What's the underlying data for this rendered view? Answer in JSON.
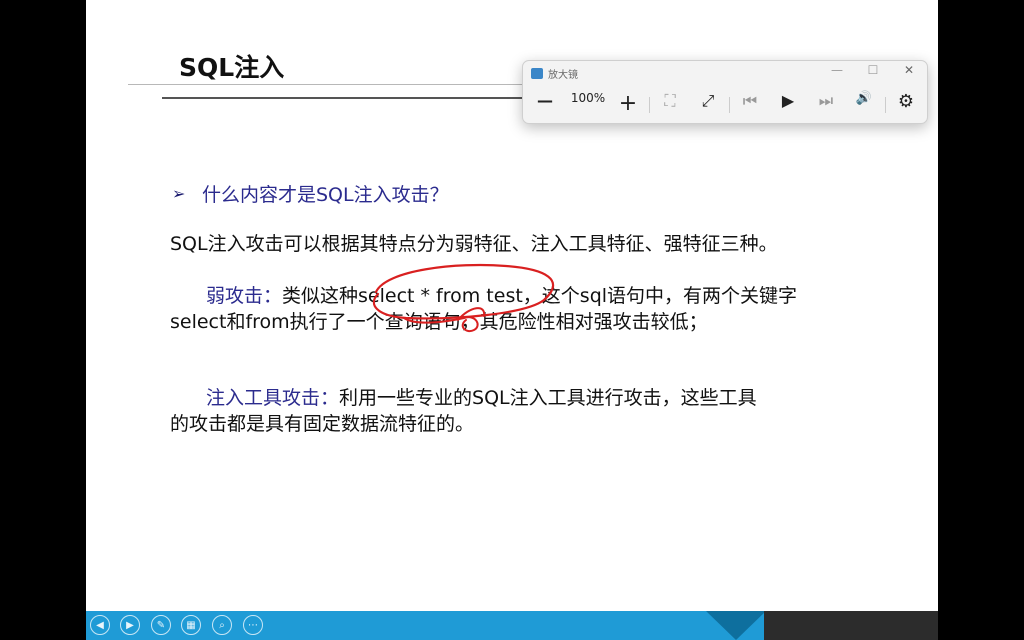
{
  "slide": {
    "title": "SQL注入",
    "bullet_arrow": "➢",
    "bullet_text": "什么内容才是SQL注入攻击？",
    "p1": "SQL注入攻击可以根据其特点分为弱特征、注入工具特征、强特征三种。",
    "p2_label": "弱攻击：",
    "p2_line1": "类似这种select * from test，这个sql语句中，有两个关键字",
    "p2_line2": "select和from执行了一个查询语句，其危险性相对强攻击较低；",
    "p3_label": "注入工具攻击：",
    "p3_line1": "利用一些专业的SQL注入工具进行攻击，这些工具",
    "p3_line2": "的攻击都是具有固定数据流特征的。"
  },
  "magnifier": {
    "title": "放大镜",
    "zoom": "100%",
    "minimize": "—",
    "maximize": "☐",
    "close": "✕",
    "zoom_out": "—",
    "zoom_in": "+",
    "fit": "⛶",
    "expand": "⤢",
    "prev": "⏮",
    "play": "▶",
    "next": "⏭",
    "read": "🔊",
    "settings": "⚙"
  },
  "footer": {
    "buttons": [
      "◀",
      "▶",
      "✎",
      "▦",
      "⌕",
      "⋯"
    ]
  },
  "colors": {
    "accent": "#2b2b8e",
    "footer_blue": "#1f9bd6",
    "ink_red": "#d92020"
  }
}
